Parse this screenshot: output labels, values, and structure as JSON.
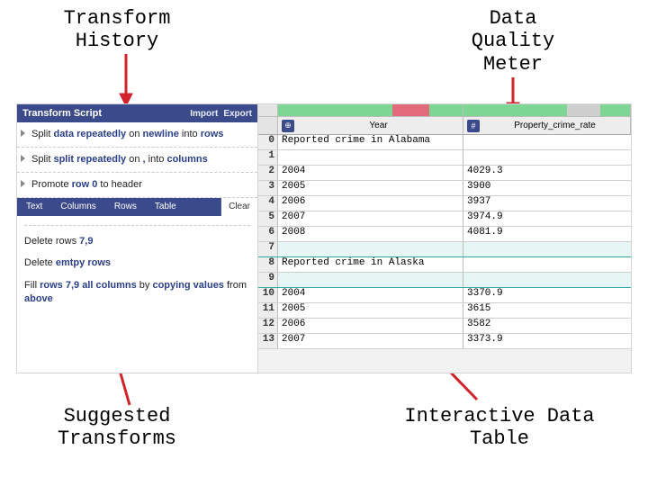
{
  "annotations": {
    "top_left": "Transform History",
    "top_right": "Data Quality Meter",
    "bottom_left": "Suggested Transforms",
    "bottom_right": "Interactive Data Table"
  },
  "left_panel": {
    "header_title": "Transform Script",
    "header_import": "Import",
    "header_export": "Export",
    "history": {
      "item0_a": "Split ",
      "item0_b": "data repeatedly",
      "item0_c": " on ",
      "item0_d": "newline",
      "item0_e": " into ",
      "item0_f": "rows",
      "item1_a": "Split ",
      "item1_b": "split repeatedly",
      "item1_c": " on ",
      "item1_d": ",",
      "item1_e": " into ",
      "item1_f": "columns",
      "item2_a": "Promote ",
      "item2_b": "row 0",
      "item2_c": " to header"
    },
    "tabs": {
      "t0": "Text",
      "t1": "Columns",
      "t2": "Rows",
      "t3": "Table",
      "clear": "Clear"
    },
    "suggestions": {
      "s0_a": "Delete rows ",
      "s0_b": "7,9",
      "s1_a": "Delete ",
      "s1_b": "emtpy rows",
      "s2_a": "Fill ",
      "s2_b": "rows 7,9",
      "s2_c": " all columns",
      "s2_d": " by ",
      "s2_e": "copying values",
      "s2_f": " from ",
      "s2_g": "above"
    }
  },
  "table": {
    "col_types": {
      "year": "⊕",
      "rate": "#"
    },
    "headers": {
      "year": "Year",
      "rate": "Property_crime_rate"
    },
    "rows": [
      {
        "n": "0",
        "year": "Reported crime in Alabama",
        "rate": "",
        "hl": false
      },
      {
        "n": "1",
        "year": "",
        "rate": "",
        "hl": false
      },
      {
        "n": "2",
        "year": "2004",
        "rate": "4029.3",
        "hl": false
      },
      {
        "n": "3",
        "year": "2005",
        "rate": "3900",
        "hl": false
      },
      {
        "n": "4",
        "year": "2006",
        "rate": "3937",
        "hl": false
      },
      {
        "n": "5",
        "year": "2007",
        "rate": "3974.9",
        "hl": false
      },
      {
        "n": "6",
        "year": "2008",
        "rate": "4081.9",
        "hl": false
      },
      {
        "n": "7",
        "year": "",
        "rate": "",
        "hl": true
      },
      {
        "n": "8",
        "year": "Reported crime in Alaska",
        "rate": "",
        "hl": false
      },
      {
        "n": "9",
        "year": "",
        "rate": "",
        "hl": true
      },
      {
        "n": "10",
        "year": "2004",
        "rate": "3370.9",
        "hl": false
      },
      {
        "n": "11",
        "year": "2005",
        "rate": "3615",
        "hl": false
      },
      {
        "n": "12",
        "year": "2006",
        "rate": "3582",
        "hl": false
      },
      {
        "n": "13",
        "year": "2007",
        "rate": "3373.9",
        "hl": false
      }
    ]
  },
  "chart_data": {
    "type": "table",
    "title": "Data preview",
    "columns": [
      "Year",
      "Property_crime_rate"
    ],
    "series": [
      {
        "name": "Alabama",
        "x": [
          2004,
          2005,
          2006,
          2007,
          2008
        ],
        "values": [
          4029.3,
          3900,
          3937,
          3974.9,
          4081.9
        ]
      },
      {
        "name": "Alaska",
        "x": [
          2004,
          2005,
          2006,
          2007
        ],
        "values": [
          3370.9,
          3615,
          3582,
          3373.9
        ]
      }
    ]
  }
}
